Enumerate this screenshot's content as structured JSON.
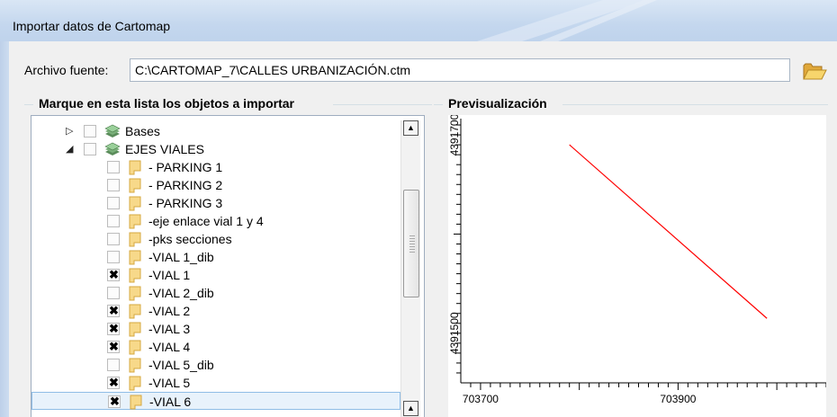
{
  "window": {
    "title": "Importar datos de Cartomap"
  },
  "source": {
    "label": "Archivo fuente:",
    "value": "C:\\CARTOMAP_7\\CALLES URBANIZACIÓN.ctm",
    "browse_icon": "folder-open-icon"
  },
  "list_group": {
    "title": "Marque en esta lista los objetos a importar"
  },
  "preview_group": {
    "title": "Previsualización"
  },
  "tree": [
    {
      "label": "Bases",
      "level": 0,
      "expanded": false,
      "checked": false,
      "icon": "layers-icon"
    },
    {
      "label": "EJES VIALES",
      "level": 0,
      "expanded": true,
      "checked": false,
      "icon": "layers-icon"
    },
    {
      "label": "- PARKING 1",
      "level": 1,
      "checked": false,
      "icon": "layer-icon"
    },
    {
      "label": "- PARKING 2",
      "level": 1,
      "checked": false,
      "icon": "layer-icon"
    },
    {
      "label": "- PARKING 3",
      "level": 1,
      "checked": false,
      "icon": "layer-icon"
    },
    {
      "label": "-eje enlace vial 1 y 4",
      "level": 1,
      "checked": false,
      "icon": "layer-icon"
    },
    {
      "label": "-pks secciones",
      "level": 1,
      "checked": false,
      "icon": "layer-icon"
    },
    {
      "label": "-VIAL 1_dib",
      "level": 1,
      "checked": false,
      "icon": "layer-icon"
    },
    {
      "label": "-VIAL 1",
      "level": 1,
      "checked": true,
      "icon": "layer-icon"
    },
    {
      "label": "-VIAL 2_dib",
      "level": 1,
      "checked": false,
      "icon": "layer-icon"
    },
    {
      "label": "-VIAL 2",
      "level": 1,
      "checked": true,
      "icon": "layer-icon"
    },
    {
      "label": "-VIAL 3",
      "level": 1,
      "checked": true,
      "icon": "layer-icon"
    },
    {
      "label": "-VIAL 4",
      "level": 1,
      "checked": true,
      "icon": "layer-icon"
    },
    {
      "label": "-VIAL 5_dib",
      "level": 1,
      "checked": false,
      "icon": "layer-icon"
    },
    {
      "label": "-VIAL 5",
      "level": 1,
      "checked": true,
      "icon": "layer-icon"
    },
    {
      "label": "-VIAL 6",
      "level": 1,
      "checked": true,
      "selected": true,
      "icon": "layer-icon"
    }
  ],
  "chart_data": {
    "type": "line",
    "title": "",
    "xlabel": "",
    "ylabel": "",
    "x_ticks": [
      "703700",
      "703900"
    ],
    "y_ticks": [
      "4391700",
      "4391500"
    ],
    "series": [
      {
        "x": [
          703790,
          703990
        ],
        "y": [
          4391690,
          4391515
        ],
        "color": "#ff0000"
      }
    ],
    "grid": false
  },
  "colors": {
    "accent": "#ff0000",
    "title_bar": "#c4d7ee",
    "selection": "#e8f2fb"
  }
}
